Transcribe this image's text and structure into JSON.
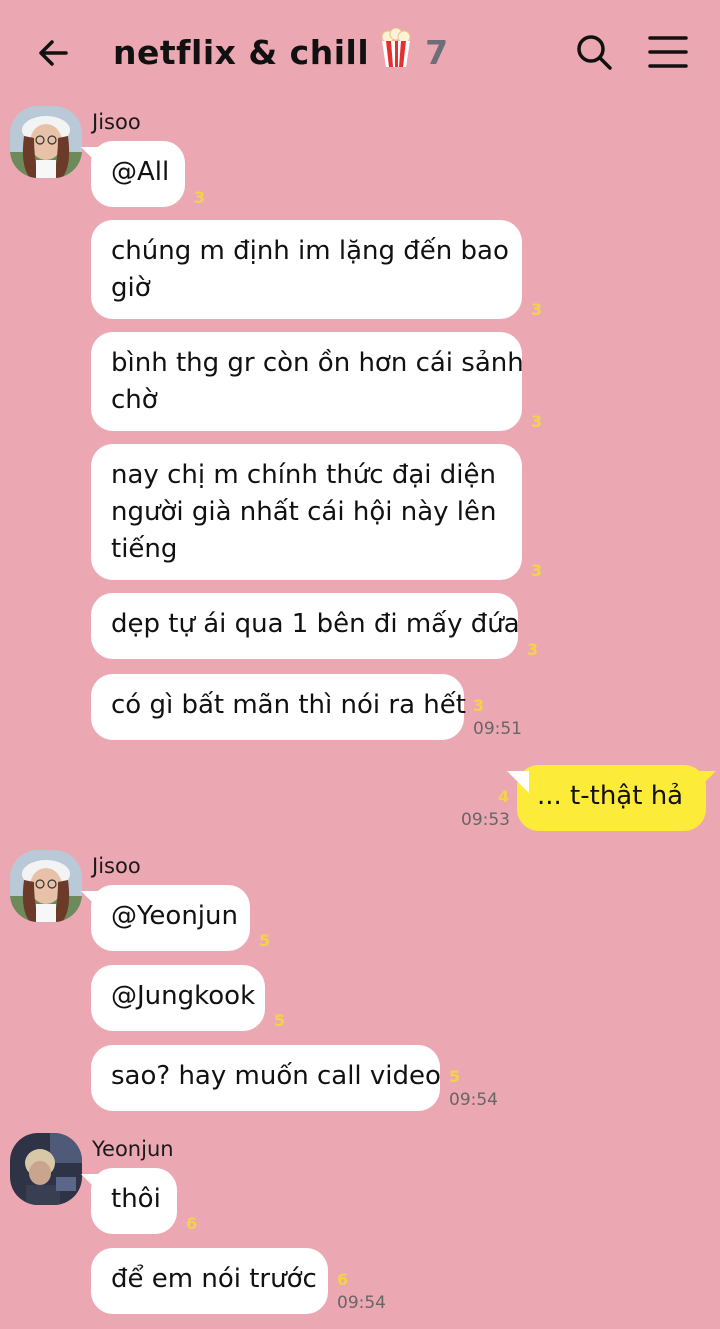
{
  "header": {
    "title": "netflix & chill",
    "emoji_icon": "popcorn-icon",
    "member_count": "7"
  },
  "messages": [
    {
      "sender": "Jisoo",
      "text": "@All",
      "unread": "3"
    },
    {
      "text_line1": "chúng m định im lặng đến bao",
      "text_line2": "giờ",
      "unread": "3"
    },
    {
      "text_line1": "bình thg gr còn ồn hơn cái sảnh",
      "text_line2": "chờ",
      "unread": "3"
    },
    {
      "text_line1": "nay chị m chính thức đại diện",
      "text_line2": "người già nhất cái hội này lên",
      "text_line3": "tiếng",
      "unread": "3"
    },
    {
      "text": "dẹp tự ái qua 1 bên đi mấy đứa",
      "unread": "3"
    },
    {
      "text": "có gì bất mãn thì nói ra hết",
      "unread": "3",
      "time": "09:51"
    },
    {
      "text": "... t-thật hả",
      "unread": "4",
      "time": "09:53"
    },
    {
      "sender": "Jisoo",
      "text": "@Yeonjun",
      "unread": "5"
    },
    {
      "text": "@Jungkook",
      "unread": "5"
    },
    {
      "text": "sao? hay muốn call video",
      "unread": "5",
      "time": "09:54"
    },
    {
      "sender": "Yeonjun",
      "text": "thôi",
      "unread": "6"
    },
    {
      "text": "để em nói trước",
      "unread": "6",
      "time": "09:54"
    }
  ],
  "colors": {
    "background": "#eca8b2",
    "my_bubble": "#fdeb3a",
    "other_bubble": "#ffffff",
    "unread": "#f3d24a"
  }
}
